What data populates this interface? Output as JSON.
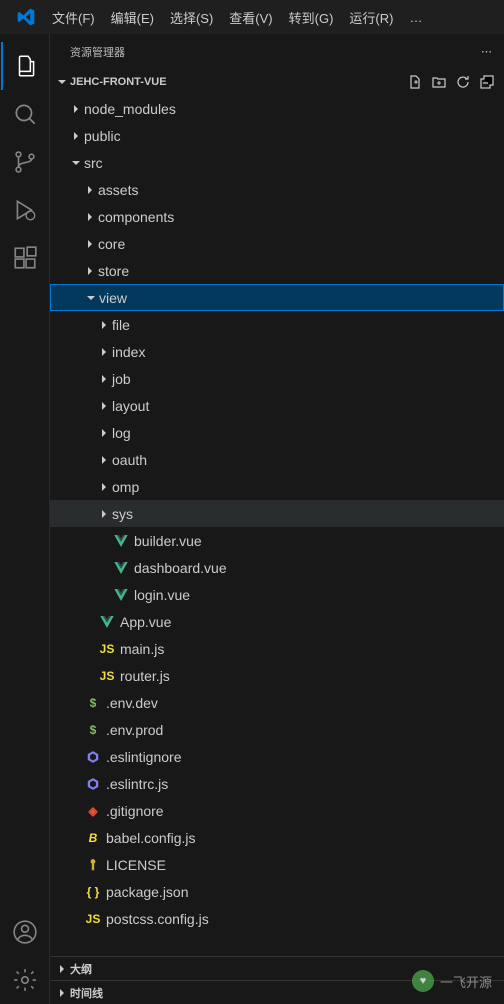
{
  "menubar": {
    "items": [
      "文件(F)",
      "编辑(E)",
      "选择(S)",
      "查看(V)",
      "转到(G)",
      "运行(R)"
    ],
    "ellipsis": "…"
  },
  "sidebar": {
    "title": "资源管理器",
    "project": "JEHC-FRONT-VUE",
    "outline": "大纲",
    "timeline": "时间线"
  },
  "tree": [
    {
      "depth": 0,
      "type": "folder",
      "expanded": false,
      "label": "node_modules"
    },
    {
      "depth": 0,
      "type": "folder",
      "expanded": false,
      "label": "public"
    },
    {
      "depth": 0,
      "type": "folder",
      "expanded": true,
      "label": "src"
    },
    {
      "depth": 1,
      "type": "folder",
      "expanded": false,
      "label": "assets"
    },
    {
      "depth": 1,
      "type": "folder",
      "expanded": false,
      "label": "components"
    },
    {
      "depth": 1,
      "type": "folder",
      "expanded": false,
      "label": "core"
    },
    {
      "depth": 1,
      "type": "folder",
      "expanded": false,
      "label": "store"
    },
    {
      "depth": 1,
      "type": "folder",
      "expanded": true,
      "label": "view",
      "selected": true
    },
    {
      "depth": 2,
      "type": "folder",
      "expanded": false,
      "label": "file"
    },
    {
      "depth": 2,
      "type": "folder",
      "expanded": false,
      "label": "index"
    },
    {
      "depth": 2,
      "type": "folder",
      "expanded": false,
      "label": "job"
    },
    {
      "depth": 2,
      "type": "folder",
      "expanded": false,
      "label": "layout"
    },
    {
      "depth": 2,
      "type": "folder",
      "expanded": false,
      "label": "log"
    },
    {
      "depth": 2,
      "type": "folder",
      "expanded": false,
      "label": "oauth"
    },
    {
      "depth": 2,
      "type": "folder",
      "expanded": false,
      "label": "omp"
    },
    {
      "depth": 2,
      "type": "folder",
      "expanded": false,
      "label": "sys",
      "hovered": true
    },
    {
      "depth": 2,
      "type": "file",
      "icon": "vue",
      "label": "builder.vue"
    },
    {
      "depth": 2,
      "type": "file",
      "icon": "vue",
      "label": "dashboard.vue"
    },
    {
      "depth": 2,
      "type": "file",
      "icon": "vue",
      "label": "login.vue"
    },
    {
      "depth": 1,
      "type": "file",
      "icon": "vue",
      "label": "App.vue"
    },
    {
      "depth": 1,
      "type": "file",
      "icon": "js",
      "label": "main.js"
    },
    {
      "depth": 1,
      "type": "file",
      "icon": "js",
      "label": "router.js"
    },
    {
      "depth": 0,
      "type": "file",
      "icon": "env",
      "label": ".env.dev"
    },
    {
      "depth": 0,
      "type": "file",
      "icon": "env",
      "label": ".env.prod"
    },
    {
      "depth": 0,
      "type": "file",
      "icon": "eslint",
      "label": ".eslintignore"
    },
    {
      "depth": 0,
      "type": "file",
      "icon": "eslint",
      "label": ".eslintrc.js"
    },
    {
      "depth": 0,
      "type": "file",
      "icon": "git",
      "label": ".gitignore"
    },
    {
      "depth": 0,
      "type": "file",
      "icon": "babel",
      "label": "babel.config.js"
    },
    {
      "depth": 0,
      "type": "file",
      "icon": "license",
      "label": "LICENSE"
    },
    {
      "depth": 0,
      "type": "file",
      "icon": "json",
      "label": "package.json"
    },
    {
      "depth": 0,
      "type": "file",
      "icon": "js",
      "label": "postcss.config.js"
    }
  ],
  "watermark": "一飞开源"
}
